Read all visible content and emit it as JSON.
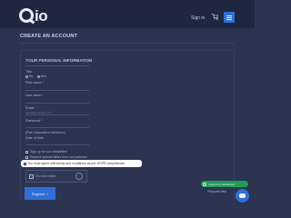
{
  "header": {
    "logo_text": "io",
    "signin_label": "Sign in",
    "cart_count": "0",
    "icons": {
      "cart": "cart-icon",
      "menu": "hamburger-menu-icon"
    }
  },
  "page": {
    "heading": "CREATE AN ACCOUNT",
    "section_title": "YOUR PERSONAL INFORMATION"
  },
  "form": {
    "title_label": "Title",
    "title_options": [
      "Mr.",
      "Mrs."
    ],
    "first_name_label": "First name *",
    "last_name_label": "Last name *",
    "email_label": "Email *",
    "email_placeholder": "name@example.com",
    "password_label": "Password *",
    "password_hint": "(Five characters minimum)",
    "dob_label": "Date of birth",
    "newsletter_label": "Sign up for our newsletter!",
    "offers_label": "Receive special offers from our partners!",
    "gdpr_label": "You must agree with terms and conditions as per GDPR compliances.",
    "captcha_label": "I'm not a robot",
    "register_label": "Register"
  },
  "widgets": {
    "whatsapp_label": "Support on WhatsApp",
    "required_note": "*Required field",
    "chat_icon": "chat-bubble-icon"
  },
  "colors": {
    "background": "#2b3450",
    "topbar": "#1f2740",
    "accent": "#2f6fd6",
    "whatsapp": "#1f9c57"
  }
}
